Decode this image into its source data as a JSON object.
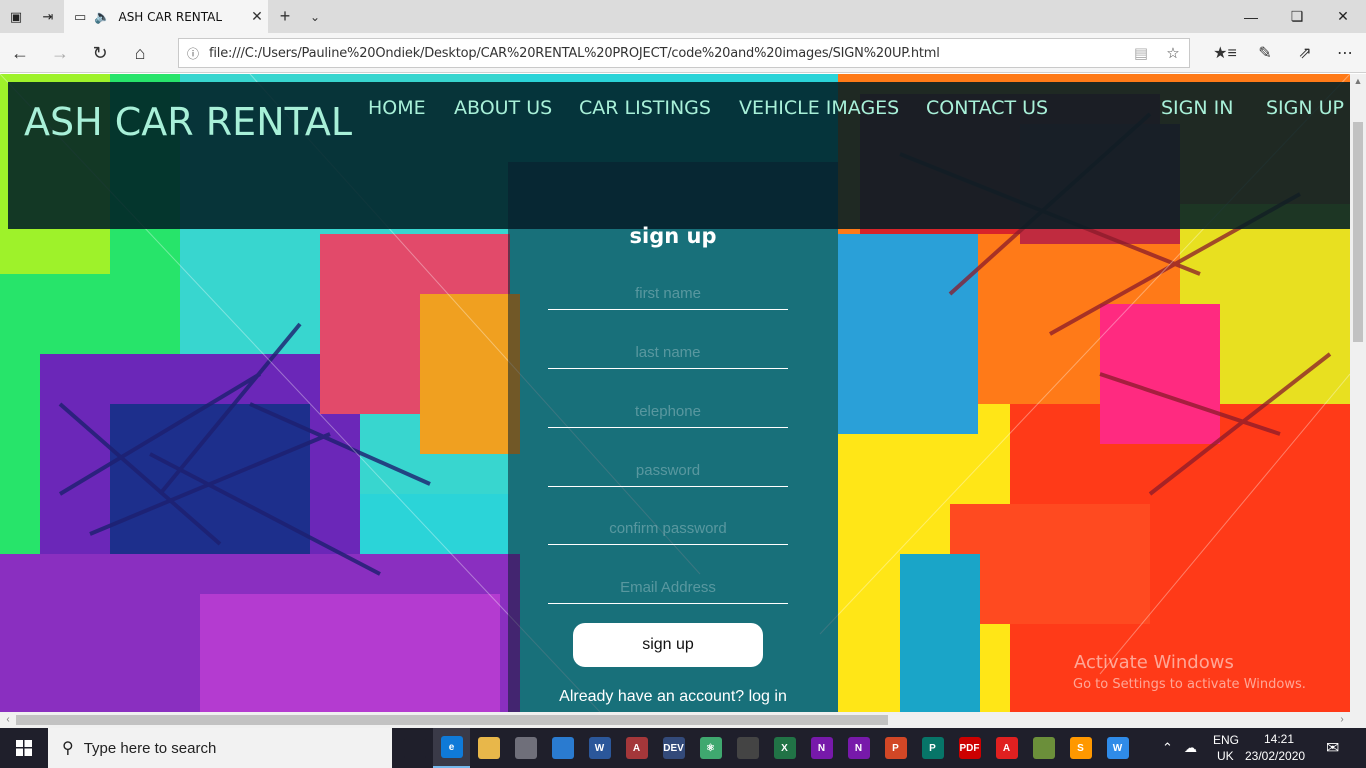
{
  "browser": {
    "tab_title": "ASH CAR RENTAL",
    "url": "file:///C:/Users/Pauline%20Ondiek/Desktop/CAR%20RENTAL%20PROJECT/code%20and%20images/SIGN%20UP.html"
  },
  "site": {
    "logo": "ASH CAR RENTAL",
    "nav": [
      "HOME",
      "ABOUT US",
      "CAR LISTINGS",
      "VEHICLE IMAGES",
      "CONTACT US"
    ],
    "auth_nav": [
      "SIGN IN",
      "SIGN UP"
    ]
  },
  "form": {
    "title": "sign up",
    "placeholders": [
      "first name",
      "last name",
      "telephone",
      "password",
      "confirm password",
      "Email Address"
    ],
    "submit_label": "sign up",
    "login_prompt": "Already have an account? log in"
  },
  "watermark": {
    "title": "Activate Windows",
    "subtitle": "Go to Settings to activate Windows."
  },
  "taskbar": {
    "search_placeholder": "Type here to search",
    "language_line1": "ENG",
    "language_line2": "UK",
    "time": "14:21",
    "date": "23/02/2020",
    "apps": [
      {
        "icon": "task-view-icon",
        "color": "#1f1f2b",
        "label": ""
      },
      {
        "icon": "edge-icon",
        "color": "#0f7ad8",
        "label": "e"
      },
      {
        "icon": "file-explorer-icon",
        "color": "#e8b74a",
        "label": ""
      },
      {
        "icon": "mail-icon",
        "color": "#6f6f7a",
        "label": ""
      },
      {
        "icon": "store-icon",
        "color": "#2a7bd0",
        "label": ""
      },
      {
        "icon": "word-icon",
        "color": "#2b579a",
        "label": "W"
      },
      {
        "icon": "access-icon",
        "color": "#a4373a",
        "label": "A"
      },
      {
        "icon": "devc-icon",
        "color": "#334a7a",
        "label": "DEV"
      },
      {
        "icon": "atom-icon",
        "color": "#3fa86f",
        "label": "⚛"
      },
      {
        "icon": "inkscape-icon",
        "color": "#444",
        "label": ""
      },
      {
        "icon": "excel-icon",
        "color": "#217346",
        "label": "X"
      },
      {
        "icon": "onenote-icon",
        "color": "#7719aa",
        "label": "N"
      },
      {
        "icon": "onenote2-icon",
        "color": "#7719aa",
        "label": "N"
      },
      {
        "icon": "powerpoint-icon",
        "color": "#d24726",
        "label": "P"
      },
      {
        "icon": "publisher-icon",
        "color": "#077568",
        "label": "P"
      },
      {
        "icon": "pdf-icon",
        "color": "#c00",
        "label": "PDF"
      },
      {
        "icon": "acrobat-icon",
        "color": "#e02020",
        "label": "A"
      },
      {
        "icon": "android-studio-icon",
        "color": "#6b8f3a",
        "label": ""
      },
      {
        "icon": "sublime-icon",
        "color": "#ff9800",
        "label": "S"
      },
      {
        "icon": "wps-icon",
        "color": "#2f8be8",
        "label": "W"
      }
    ]
  }
}
